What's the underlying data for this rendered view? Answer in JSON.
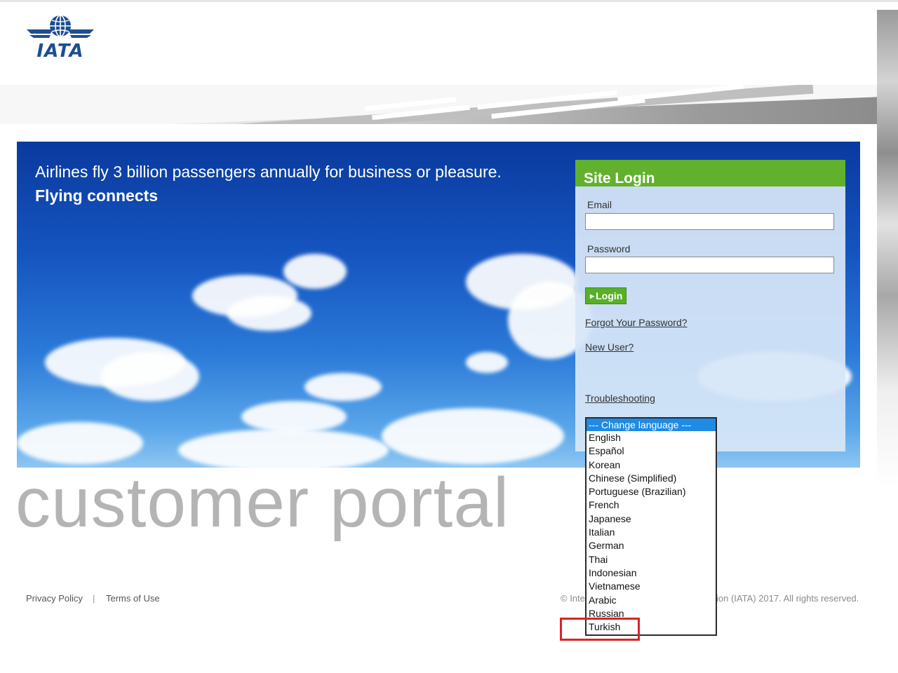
{
  "logo": {
    "text": "IATA"
  },
  "hero": {
    "tagline": "Airlines fly 3 billion passengers annually for business or pleasure.",
    "headline": "Flying connects"
  },
  "login": {
    "title": "Site Login",
    "email_label": "Email",
    "email_value": "",
    "password_label": "Password",
    "password_value": "",
    "button_label": "Login",
    "forgot_link": "Forgot Your Password?",
    "new_user_link": "New User?",
    "troubleshooting_link": "Troubleshooting"
  },
  "watermark": "customer portal",
  "footer": {
    "privacy": "Privacy Policy",
    "separator": "|",
    "terms": "Terms of Use",
    "copyright_left": "© Inte",
    "copyright_right": "ion (IATA) 2017. All rights reserved."
  },
  "language_dropdown": {
    "selected": "--- Change language ---",
    "options": [
      "English",
      "Español",
      "Korean",
      "Chinese (Simplified)",
      "Portuguese (Brazilian)",
      "French",
      "Japanese",
      "Italian",
      "German",
      "Thai",
      "Indonesian",
      "Vietnamese",
      "Arabic",
      "Russian",
      "Turkish"
    ],
    "highlighted": "Turkish"
  },
  "colors": {
    "brand_blue": "#1d4e92",
    "login_header_green": "#62b12d",
    "login_button_green": "#58b027",
    "select_highlight_blue": "#1e8be6",
    "annotation_red": "#d9232a"
  },
  "icons": {
    "logo": "globe-wings-icon",
    "button": "arrow-right-icon"
  }
}
